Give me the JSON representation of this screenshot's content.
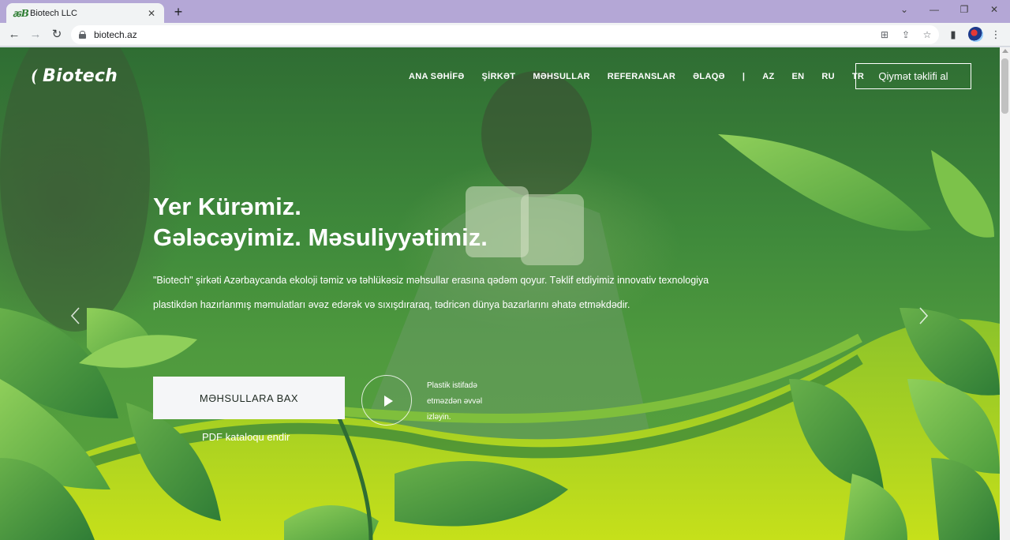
{
  "browser": {
    "tab_title": "Biotech LLC",
    "tab_favicon": "ꬱB",
    "tab_close": "✕",
    "new_tab": "+",
    "url": "biotech.az",
    "window_controls": {
      "menu": "⌄",
      "minimize": "—",
      "maximize": "❐",
      "close": "✕"
    },
    "nav": {
      "back": "←",
      "forward": "→",
      "reload": "↻"
    },
    "toolbar_icons": {
      "translate": "⊞",
      "share": "⇪",
      "bookmark": "☆",
      "side_panel": "▮",
      "menu": "⋮"
    }
  },
  "site": {
    "logo_text": "Biotech",
    "nav_items": [
      "ANA SƏHİFƏ",
      "ŞİRKƏT",
      "MƏHSULLAR",
      "REFERANSLAR",
      "ƏLAQƏ",
      "|",
      "AZ",
      "EN",
      "RU",
      "TR"
    ],
    "cta": "Qiymət təklifi al"
  },
  "hero": {
    "title_line1": "Yer Kürəmiz.",
    "title_line2": "Gələcəyimiz. Məsuliyyətimiz.",
    "description": "\"Biotech\" şirkəti Azərbaycanda ekoloji təmiz və təhlükəsiz məhsullar erasına qədəm qoyur. Təklif etdiyimiz innovativ texnologiya plastikdən hazırlanmış məmulatları əvəz edərək və sıxışdıraraq, tədricən dünya bazarlarını əhatə etməkdədir.",
    "button_products": "MƏHSULLARA BAX",
    "pdf_link": "PDF kataloqu endir",
    "video_text": "Plastik istifadə etməzdən əvvəl izləyin."
  },
  "colors": {
    "tabbar": "#b4a7d6",
    "toolbar": "#f1f3f4",
    "hero_dark": "#2f6d33",
    "leaf_bright": "#c6e01a",
    "leaf_green": "#4e9e3e",
    "button_bg": "#f5f6f8"
  }
}
